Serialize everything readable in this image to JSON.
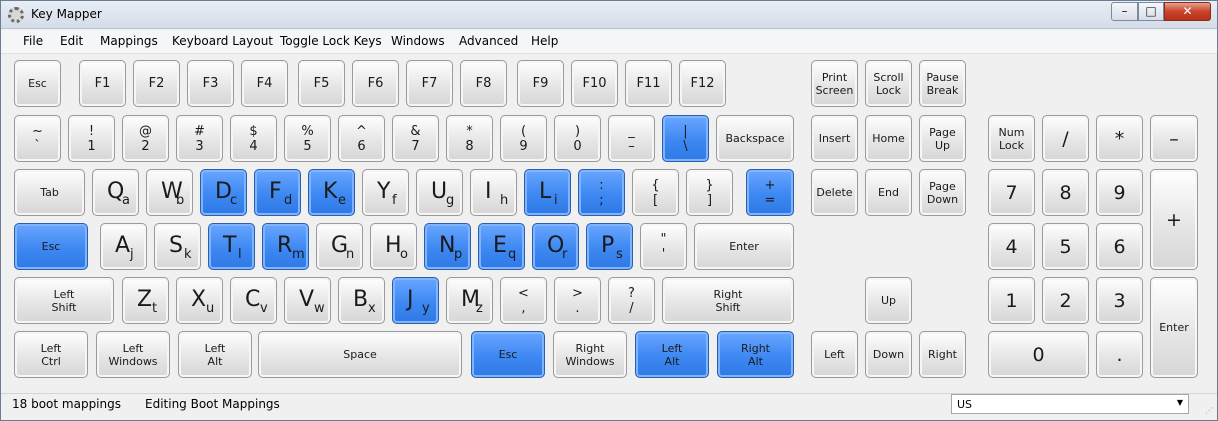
{
  "window": {
    "title": "Key Mapper",
    "min": "–",
    "max": "□",
    "close": "✕"
  },
  "menu": [
    {
      "name": "menu-file",
      "label": "File"
    },
    {
      "name": "menu-edit",
      "label": "Edit"
    },
    {
      "name": "menu-mappings",
      "label": "Mappings"
    },
    {
      "name": "menu-keyboard-layout",
      "label": "Keyboard Layout"
    },
    {
      "name": "menu-toggle-lock-keys",
      "label": "Toggle Lock Keys"
    },
    {
      "name": "menu-windows",
      "label": "Windows"
    },
    {
      "name": "menu-advanced",
      "label": "Advanced"
    },
    {
      "name": "menu-help",
      "label": "Help"
    }
  ],
  "keys": [
    {
      "id": "esc",
      "t": "s",
      "a": "Esc",
      "m": false
    },
    {
      "id": "f1",
      "t": "d",
      "a": "F1",
      "m": false
    },
    {
      "id": "f2",
      "t": "d",
      "a": "F2",
      "m": false
    },
    {
      "id": "f3",
      "t": "d",
      "a": "F3",
      "m": false
    },
    {
      "id": "f4",
      "t": "d",
      "a": "F4",
      "m": false
    },
    {
      "id": "f5",
      "t": "d",
      "a": "F5",
      "m": false
    },
    {
      "id": "f6",
      "t": "d",
      "a": "F6",
      "m": false
    },
    {
      "id": "f7",
      "t": "d",
      "a": "F7",
      "m": false
    },
    {
      "id": "f8",
      "t": "d",
      "a": "F8",
      "m": false
    },
    {
      "id": "f9",
      "t": "d",
      "a": "F9",
      "m": false
    },
    {
      "id": "f10",
      "t": "d",
      "a": "F10",
      "m": false
    },
    {
      "id": "f11",
      "t": "d",
      "a": "F11",
      "m": false
    },
    {
      "id": "f12",
      "t": "d",
      "a": "F12",
      "m": false
    },
    {
      "id": "print-screen",
      "t": "s2",
      "a": "Print",
      "b": "Screen",
      "m": false
    },
    {
      "id": "scroll-lock",
      "t": "s2",
      "a": "Scroll",
      "b": "Lock",
      "m": false
    },
    {
      "id": "pause-break",
      "t": "s2",
      "a": "Pause",
      "b": "Break",
      "m": false
    },
    {
      "id": "backtick",
      "t": "sym",
      "a": "~",
      "b": "`",
      "m": false
    },
    {
      "id": "1",
      "t": "sym",
      "a": "!",
      "b": "1",
      "m": false
    },
    {
      "id": "2",
      "t": "sym",
      "a": "@",
      "b": "2",
      "m": false
    },
    {
      "id": "3",
      "t": "sym",
      "a": "#",
      "b": "3",
      "m": false
    },
    {
      "id": "4",
      "t": "sym",
      "a": "$",
      "b": "4",
      "m": false
    },
    {
      "id": "5",
      "t": "sym",
      "a": "%",
      "b": "5",
      "m": false
    },
    {
      "id": "6",
      "t": "sym",
      "a": "^",
      "b": "6",
      "m": false
    },
    {
      "id": "7",
      "t": "sym",
      "a": "&",
      "b": "7",
      "m": false
    },
    {
      "id": "8",
      "t": "sym",
      "a": "*",
      "b": "8",
      "m": false
    },
    {
      "id": "9",
      "t": "sym",
      "a": "(",
      "b": "9",
      "m": false
    },
    {
      "id": "0",
      "t": "sym",
      "a": ")",
      "b": "0",
      "m": false
    },
    {
      "id": "minus",
      "t": "sym",
      "a": "_",
      "b": "–",
      "m": false
    },
    {
      "id": "equals",
      "t": "sym",
      "a": "|",
      "b": "\\",
      "m": true
    },
    {
      "id": "backspace",
      "t": "s",
      "a": "Backspace",
      "m": false
    },
    {
      "id": "insert",
      "t": "s",
      "a": "Insert",
      "m": false
    },
    {
      "id": "home",
      "t": "s",
      "a": "Home",
      "m": false
    },
    {
      "id": "page-up",
      "t": "s2",
      "a": "Page",
      "b": "Up",
      "m": false
    },
    {
      "id": "num-lock",
      "t": "s2",
      "a": "Num",
      "b": "Lock",
      "m": false
    },
    {
      "id": "num-divide",
      "t": "n",
      "a": "/",
      "m": false
    },
    {
      "id": "num-multiply",
      "t": "n",
      "a": "*",
      "m": false
    },
    {
      "id": "num-minus",
      "t": "n",
      "a": "–",
      "m": false
    },
    {
      "id": "tab",
      "t": "s",
      "a": "Tab",
      "m": false
    },
    {
      "id": "q",
      "t": "ls",
      "a": "Q",
      "b": "a",
      "m": false
    },
    {
      "id": "w",
      "t": "ls",
      "a": "W",
      "b": "b",
      "m": false
    },
    {
      "id": "e",
      "t": "ls",
      "a": "D",
      "b": "c",
      "m": true
    },
    {
      "id": "r",
      "t": "ls",
      "a": "F",
      "b": "d",
      "m": true
    },
    {
      "id": "t",
      "t": "ls",
      "a": "K",
      "b": "e",
      "m": true
    },
    {
      "id": "y",
      "t": "ls",
      "a": "Y",
      "b": "f",
      "m": false
    },
    {
      "id": "u",
      "t": "ls",
      "a": "U",
      "b": "g",
      "m": false
    },
    {
      "id": "i",
      "t": "ls",
      "a": "I",
      "b": "h",
      "m": false
    },
    {
      "id": "o",
      "t": "ls",
      "a": "L",
      "b": "i",
      "m": true
    },
    {
      "id": "p",
      "t": "sym",
      "a": ":",
      "b": ";",
      "m": true
    },
    {
      "id": "lbracket",
      "t": "sym",
      "a": "{",
      "b": "[",
      "m": false
    },
    {
      "id": "rbracket",
      "t": "sym",
      "a": "}",
      "b": "]",
      "m": false
    },
    {
      "id": "backslash",
      "t": "sym",
      "a": "+",
      "b": "=",
      "m": true
    },
    {
      "id": "delete",
      "t": "s",
      "a": "Delete",
      "m": false
    },
    {
      "id": "end",
      "t": "s",
      "a": "End",
      "m": false
    },
    {
      "id": "page-down",
      "t": "s2",
      "a": "Page",
      "b": "Down",
      "m": false
    },
    {
      "id": "num-7",
      "t": "n",
      "a": "7",
      "m": false
    },
    {
      "id": "num-8",
      "t": "n",
      "a": "8",
      "m": false
    },
    {
      "id": "num-9",
      "t": "n",
      "a": "9",
      "m": false
    },
    {
      "id": "num-plus",
      "t": "n",
      "a": "+",
      "m": false
    },
    {
      "id": "caps-lock",
      "t": "s",
      "a": "Esc",
      "m": true
    },
    {
      "id": "a",
      "t": "ls",
      "a": "A",
      "b": "j",
      "m": false
    },
    {
      "id": "s",
      "t": "ls",
      "a": "S",
      "b": "k",
      "m": false
    },
    {
      "id": "d",
      "t": "ls",
      "a": "T",
      "b": "l",
      "m": true
    },
    {
      "id": "f",
      "t": "ls",
      "a": "R",
      "b": "m",
      "m": true
    },
    {
      "id": "g",
      "t": "ls",
      "a": "G",
      "b": "n",
      "m": false
    },
    {
      "id": "h",
      "t": "ls",
      "a": "H",
      "b": "o",
      "m": false
    },
    {
      "id": "j",
      "t": "ls",
      "a": "N",
      "b": "p",
      "m": true
    },
    {
      "id": "k",
      "t": "ls",
      "a": "E",
      "b": "q",
      "m": true
    },
    {
      "id": "l",
      "t": "ls",
      "a": "O",
      "b": "r",
      "m": true
    },
    {
      "id": "semicolon",
      "t": "ls",
      "a": "P",
      "b": "s",
      "m": true
    },
    {
      "id": "quote",
      "t": "sym",
      "a": "\"",
      "b": "'",
      "m": false
    },
    {
      "id": "enter",
      "t": "s",
      "a": "Enter",
      "m": false
    },
    {
      "id": "num-4",
      "t": "n",
      "a": "4",
      "m": false
    },
    {
      "id": "num-5",
      "t": "n",
      "a": "5",
      "m": false
    },
    {
      "id": "num-6",
      "t": "n",
      "a": "6",
      "m": false
    },
    {
      "id": "left-shift",
      "t": "s2",
      "a": "Left",
      "b": "Shift",
      "m": false
    },
    {
      "id": "z",
      "t": "ls",
      "a": "Z",
      "b": "t",
      "m": false
    },
    {
      "id": "x",
      "t": "ls",
      "a": "X",
      "b": "u",
      "m": false
    },
    {
      "id": "c",
      "t": "ls",
      "a": "C",
      "b": "v",
      "m": false
    },
    {
      "id": "v",
      "t": "ls",
      "a": "V",
      "b": "w",
      "m": false
    },
    {
      "id": "b",
      "t": "ls",
      "a": "B",
      "b": "x",
      "m": false
    },
    {
      "id": "n",
      "t": "ls",
      "a": "J",
      "b": "y",
      "m": true
    },
    {
      "id": "m",
      "t": "ls",
      "a": "M",
      "b": "z",
      "m": false
    },
    {
      "id": "comma",
      "t": "sym",
      "a": "<",
      "b": ",",
      "m": false
    },
    {
      "id": "period",
      "t": "sym",
      "a": ">",
      "b": ".",
      "m": false
    },
    {
      "id": "slash",
      "t": "sym",
      "a": "?",
      "b": "/",
      "m": false
    },
    {
      "id": "right-shift",
      "t": "s2",
      "a": "Right",
      "b": "Shift",
      "m": false
    },
    {
      "id": "up",
      "t": "s",
      "a": "Up",
      "m": false
    },
    {
      "id": "num-1",
      "t": "n",
      "a": "1",
      "m": false
    },
    {
      "id": "num-2",
      "t": "n",
      "a": "2",
      "m": false
    },
    {
      "id": "num-3",
      "t": "n",
      "a": "3",
      "m": false
    },
    {
      "id": "num-enter",
      "t": "s",
      "a": "Enter",
      "m": false
    },
    {
      "id": "left-ctrl",
      "t": "s2",
      "a": "Left",
      "b": "Ctrl",
      "m": false
    },
    {
      "id": "left-windows",
      "t": "s2",
      "a": "Left",
      "b": "Windows",
      "m": false
    },
    {
      "id": "left-alt",
      "t": "s2",
      "a": "Left",
      "b": "Alt",
      "m": false
    },
    {
      "id": "space",
      "t": "s",
      "a": "Space",
      "m": false
    },
    {
      "id": "right-alt-key",
      "t": "s",
      "a": "Esc",
      "m": true
    },
    {
      "id": "right-windows",
      "t": "s2",
      "a": "Right",
      "b": "Windows",
      "m": false
    },
    {
      "id": "menu-key",
      "t": "s2",
      "a": "Left",
      "b": "Alt",
      "m": true
    },
    {
      "id": "right-ctrl",
      "t": "s2",
      "a": "Right",
      "b": "Alt",
      "m": true
    },
    {
      "id": "left",
      "t": "s",
      "a": "Left",
      "m": false
    },
    {
      "id": "down",
      "t": "s",
      "a": "Down",
      "m": false
    },
    {
      "id": "right",
      "t": "s",
      "a": "Right",
      "m": false
    },
    {
      "id": "num-0",
      "t": "n",
      "a": "0",
      "m": false
    },
    {
      "id": "num-decimal",
      "t": "n",
      "a": ".",
      "m": false
    }
  ],
  "status": {
    "count": "18 boot mappings",
    "mode": "Editing Boot Mappings",
    "layout": "US"
  },
  "colors": {
    "mapped": "#3d88f2",
    "key": "#e4e4e4"
  }
}
